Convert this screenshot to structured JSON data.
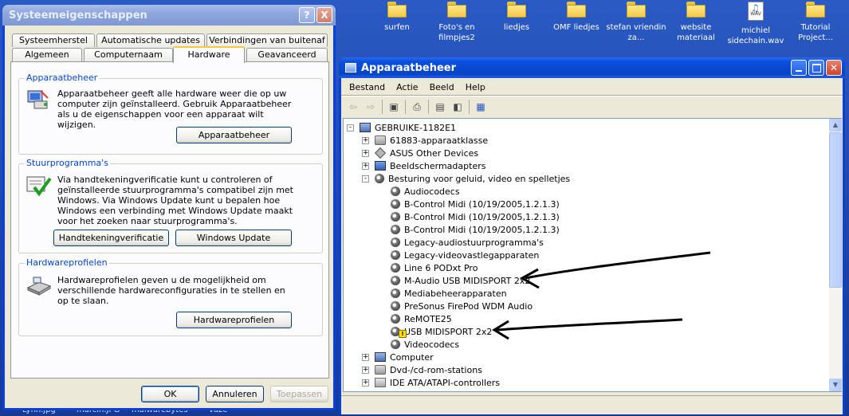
{
  "desktop": {
    "icons": [
      {
        "label": "surfen",
        "icon": "folder-icon"
      },
      {
        "label": "Foto's en filmpjes2",
        "icon": "folder-icon"
      },
      {
        "label": "liedjes",
        "icon": "folder-icon"
      },
      {
        "label": "OMF liedjes",
        "icon": "folder-icon"
      },
      {
        "label": "stefan vriendin za...",
        "icon": "folder-icon"
      },
      {
        "label": "website materiaal",
        "icon": "folder-icon"
      },
      {
        "label": "michiel sidechain.wav",
        "icon": "wav-file-icon",
        "file_badge": "WAV"
      },
      {
        "label": "Tutorial Project...",
        "icon": "folder-icon"
      }
    ],
    "bottom_labels": [
      "Lynn.jpg",
      "marcin.JPG",
      "malwarebytes",
      "vaze"
    ]
  },
  "sysprops": {
    "title": "Systeemeigenschappen",
    "help_btn": "?",
    "close_btn": "X",
    "tabs_row1": [
      "Systeemherstel",
      "Automatische updates",
      "Verbindingen van buitenaf"
    ],
    "tabs_row2": [
      "Algemeen",
      "Computernaam",
      "Hardware",
      "Geavanceerd"
    ],
    "selected_tab": "Hardware",
    "groups": {
      "devmgr": {
        "legend": "Apparaatbeheer",
        "text": "Apparaatbeheer geeft alle hardware weer die op uw computer zijn geïnstalleerd. Gebruik Apparaatbeheer als u de eigenschappen voor een apparaat wilt wijzigen.",
        "button": "Apparaatbeheer"
      },
      "drivers": {
        "legend": "Stuurprogramma's",
        "text": "Via handtekeningverificatie kunt u controleren of geïnstalleerde stuurprogramma's compatibel zijn met Windows. Via Windows Update kunt u bepalen hoe Windows een verbinding met Windows Update maakt voor het zoeken naar stuurprogramma's.",
        "button1": "Handtekeningverificatie",
        "button2": "Windows Update"
      },
      "profiles": {
        "legend": "Hardwareprofielen",
        "text": "Hardwareprofielen geven u de mogelijkheid om verschillende hardwareconfiguraties in te stellen en op te slaan.",
        "button": "Hardwareprofielen"
      }
    },
    "ok": "OK",
    "cancel": "Annuleren",
    "apply": "Toepassen"
  },
  "devmgr": {
    "title": "Apparaatbeheer",
    "menu": [
      "Bestand",
      "Actie",
      "Beeld",
      "Help"
    ],
    "toolbar_icons": [
      "back-arrow-icon",
      "forward-arrow-icon",
      "console-tree-icon",
      "print-icon",
      "properties-icon",
      "help-pane-icon",
      "scan-hardware-icon"
    ],
    "tree": [
      {
        "label": "GEBRUIKE-1182E1",
        "level": 0,
        "expander": "-",
        "icon": "computer-icon"
      },
      {
        "label": "61883-apparaatklasse",
        "level": 1,
        "expander": "+",
        "icon": "disk-icon"
      },
      {
        "label": "ASUS Other Devices",
        "level": 1,
        "expander": "+",
        "icon": "diamond-icon"
      },
      {
        "label": "Beeldschermadapters",
        "level": 1,
        "expander": "+",
        "icon": "display-adapter-icon"
      },
      {
        "label": "Besturing voor geluid, video en spelletjes",
        "level": 1,
        "expander": "-",
        "icon": "speaker-icon"
      },
      {
        "label": "Audiocodecs",
        "level": 2,
        "icon": "speaker-icon"
      },
      {
        "label": "B-Control Midi (10/19/2005,1.2.1.3)",
        "level": 2,
        "icon": "speaker-icon"
      },
      {
        "label": "B-Control Midi (10/19/2005,1.2.1.3)",
        "level": 2,
        "icon": "speaker-icon"
      },
      {
        "label": "B-Control Midi (10/19/2005,1.2.1.3)",
        "level": 2,
        "icon": "speaker-icon"
      },
      {
        "label": "Legacy-audiostuurprogramma's",
        "level": 2,
        "icon": "speaker-icon"
      },
      {
        "label": "Legacy-videovastlegapparaten",
        "level": 2,
        "icon": "speaker-icon"
      },
      {
        "label": "Line 6 PODxt Pro",
        "level": 2,
        "icon": "speaker-icon"
      },
      {
        "label": "M-Audio USB MIDISPORT 2x2",
        "level": 2,
        "icon": "speaker-icon"
      },
      {
        "label": "Mediabeheerapparaten",
        "level": 2,
        "icon": "speaker-icon"
      },
      {
        "label": "PreSonus FirePod WDM Audio",
        "level": 2,
        "icon": "speaker-icon"
      },
      {
        "label": "ReMOTE25",
        "level": 2,
        "icon": "speaker-icon"
      },
      {
        "label": "USB MIDISPORT 2x2",
        "level": 2,
        "icon": "speaker-icon",
        "warning": true
      },
      {
        "label": "Videocodecs",
        "level": 2,
        "icon": "speaker-icon"
      },
      {
        "label": "Computer",
        "level": 1,
        "expander": "+",
        "icon": "computer-icon"
      },
      {
        "label": "Dvd-/cd-rom-stations",
        "level": 1,
        "expander": "+",
        "icon": "cdrom-icon"
      },
      {
        "label": "IDE ATA/ATAPI-controllers",
        "level": 1,
        "expander": "+",
        "icon": "ide-controller-icon"
      }
    ],
    "annotation_arrows": [
      "M-Audio USB MIDISPORT 2x2",
      "USB MIDISPORT 2x2"
    ]
  }
}
